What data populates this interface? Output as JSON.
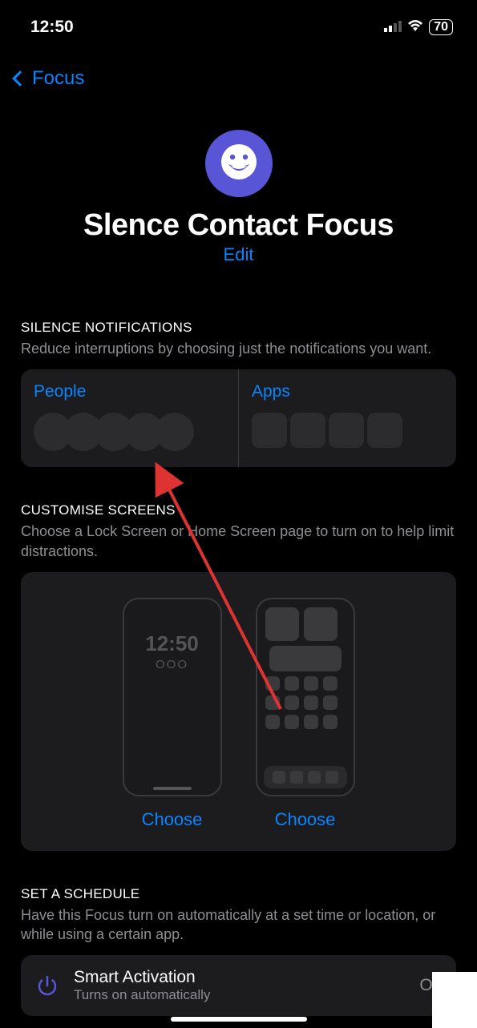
{
  "status": {
    "time": "12:50",
    "battery": "70"
  },
  "nav": {
    "back_label": "Focus"
  },
  "focus": {
    "title": "Slence Contact Focus",
    "edit_label": "Edit",
    "icon": "grinning-face"
  },
  "silence": {
    "header": "SILENCE NOTIFICATIONS",
    "desc": "Reduce interruptions by choosing just the notifications you want.",
    "people_label": "People",
    "apps_label": "Apps"
  },
  "customise": {
    "header": "CUSTOMISE SCREENS",
    "desc": "Choose a Lock Screen or Home Screen page to turn on to help limit distractions.",
    "choose_label": "Choose",
    "lock_time": "12:50",
    "lock_dots": "OOO"
  },
  "schedule": {
    "header": "SET A SCHEDULE",
    "desc": "Have this Focus turn on automatically at a set time or location, or while using a certain app.",
    "smart_title": "Smart Activation",
    "smart_sub": "Turns on automatically",
    "smart_value": "Off"
  }
}
